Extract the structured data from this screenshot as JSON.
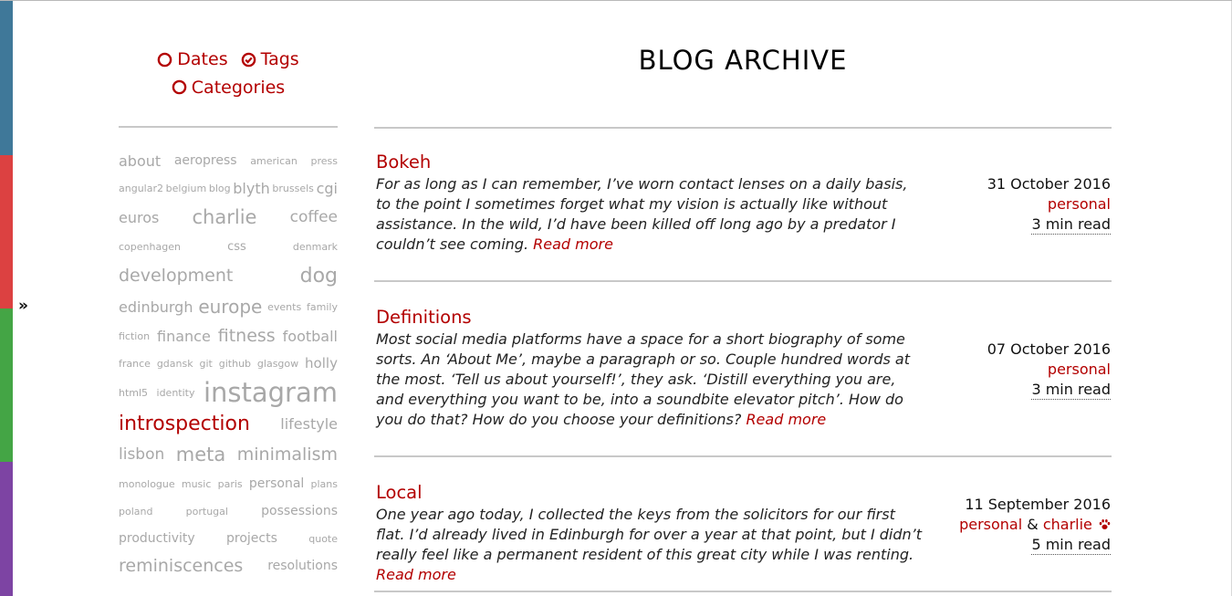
{
  "colors": {
    "accent": "#b30000",
    "tag_grey": "#a8a8a8",
    "stripes": [
      "#3f7899",
      "#dc4141",
      "#44a545",
      "#7d44a3"
    ]
  },
  "sidebar": {
    "toggle_label": "»",
    "modes": [
      {
        "label": "Dates",
        "selected": false,
        "icon": "radio-empty-icon"
      },
      {
        "label": "Tags",
        "selected": true,
        "icon": "check-circle-icon"
      },
      {
        "label": "Categories",
        "selected": false,
        "icon": "radio-empty-icon"
      }
    ],
    "tag_rows": [
      [
        {
          "t": "about",
          "s": 16
        },
        {
          "t": "aeropress",
          "s": 14
        },
        {
          "t": "american",
          "s": 11
        },
        {
          "t": "press",
          "s": 11
        }
      ],
      [
        {
          "t": "angular2",
          "s": 11
        },
        {
          "t": "belgium",
          "s": 11
        },
        {
          "t": "blog",
          "s": 11
        },
        {
          "t": "blyth",
          "s": 16
        },
        {
          "t": "brussels",
          "s": 11
        },
        {
          "t": "cgi",
          "s": 16
        }
      ],
      [
        {
          "t": "euros",
          "s": 16
        },
        {
          "t": "charlie",
          "s": 21
        },
        {
          "t": "coffee",
          "s": 17
        }
      ],
      [
        {
          "t": "copenhagen",
          "s": 11
        },
        {
          "t": "css",
          "s": 13
        },
        {
          "t": "denmark",
          "s": 11
        }
      ],
      [
        {
          "t": "development",
          "s": 19
        },
        {
          "t": "dog",
          "s": 22
        }
      ],
      [
        {
          "t": "edinburgh",
          "s": 16
        },
        {
          "t": "europe",
          "s": 20
        },
        {
          "t": "events",
          "s": 11
        },
        {
          "t": "family",
          "s": 11
        }
      ],
      [
        {
          "t": "fiction",
          "s": 11
        },
        {
          "t": "finance",
          "s": 16
        },
        {
          "t": "fitness",
          "s": 19
        },
        {
          "t": "football",
          "s": 16
        }
      ],
      [
        {
          "t": "france",
          "s": 11
        },
        {
          "t": "gdansk",
          "s": 11
        },
        {
          "t": "git",
          "s": 11
        },
        {
          "t": "github",
          "s": 11
        },
        {
          "t": "glasgow",
          "s": 11
        },
        {
          "t": "holly",
          "s": 15
        }
      ],
      [
        {
          "t": "html5",
          "s": 11
        },
        {
          "t": "identity",
          "s": 11
        },
        {
          "t": "instagram",
          "s": 29
        }
      ],
      [
        {
          "t": "introspection",
          "s": 22,
          "hl": true
        },
        {
          "t": "lifestyle",
          "s": 16
        }
      ],
      [
        {
          "t": "lisbon",
          "s": 17
        },
        {
          "t": "meta",
          "s": 21
        },
        {
          "t": "minimalism",
          "s": 19
        }
      ],
      [
        {
          "t": "monologue",
          "s": 11
        },
        {
          "t": "music",
          "s": 11
        },
        {
          "t": "paris",
          "s": 11
        },
        {
          "t": "personal",
          "s": 14
        },
        {
          "t": "plans",
          "s": 11
        }
      ],
      [
        {
          "t": "poland",
          "s": 11
        },
        {
          "t": "portugal",
          "s": 11
        },
        {
          "t": "possessions",
          "s": 14
        }
      ],
      [
        {
          "t": "productivity",
          "s": 14
        },
        {
          "t": "projects",
          "s": 14
        },
        {
          "t": "quote",
          "s": 11
        }
      ],
      [
        {
          "t": "reminiscences",
          "s": 19
        },
        {
          "t": "resolutions",
          "s": 14
        }
      ]
    ]
  },
  "main": {
    "title": "BLOG ARCHIVE",
    "posts": [
      {
        "title": "Bokeh",
        "excerpt": "For as long as I can remember, I’ve worn contact lenses on a daily basis, to the point I sometimes forget what my vision is actually like without assistance. In the wild, I’d have been killed off long ago by a predator I couldn’t see coming.",
        "read_more": "Read more",
        "date": "31 October 2016",
        "categories": [
          "personal"
        ],
        "reading_time": "3 min read"
      },
      {
        "title": "Definitions",
        "excerpt": "Most social media platforms have a space for a short biography of some sorts. An ‘About Me’, maybe a paragraph or so. Couple hundred words at the most. ‘Tell us about yourself!’, they ask. ‘Distill everything you are, and everything you want to be, into a soundbite elevator pitch’. How do you do that? How do you choose your definitions?",
        "read_more": "Read more",
        "date": "07 October 2016",
        "categories": [
          "personal"
        ],
        "reading_time": "3 min read"
      },
      {
        "title": "Local",
        "excerpt": "One year ago today, I collected the keys from the solicitors for our first flat. I’d already lived in Edinburgh for over a year at that point, but I didn’t really feel like a permanent resident of this great city while I was renting.",
        "read_more": "Read more",
        "date": "11 September 2016",
        "categories": [
          "personal",
          "charlie"
        ],
        "category_separator": "&",
        "reading_time": "5 min read"
      }
    ]
  }
}
